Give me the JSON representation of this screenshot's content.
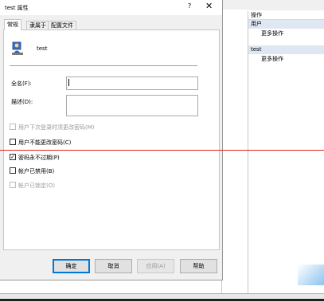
{
  "dialog": {
    "title": "test 属性",
    "help": "?",
    "close": "✕"
  },
  "tabs": [
    {
      "label": "常规"
    },
    {
      "label": "隶属于"
    },
    {
      "label": "配置文件"
    }
  ],
  "general": {
    "username": "test",
    "fullname_label": "全名(F):",
    "fullname_value": "",
    "description_label": "描述(D):",
    "description_value": "",
    "checkboxes": [
      {
        "label": "用户下次登录时须更改密码(M)",
        "checked": false,
        "enabled": false
      },
      {
        "label": "用户不能更改密码(C)",
        "checked": false,
        "enabled": true
      },
      {
        "label": "密码永不过期(P)",
        "checked": true,
        "enabled": true
      },
      {
        "label": "帐户已禁用(B)",
        "checked": false,
        "enabled": true
      },
      {
        "label": "帐户已锁定(O)",
        "checked": false,
        "enabled": false
      }
    ]
  },
  "buttons": {
    "ok": "确定",
    "cancel": "取消",
    "apply": "应用(A)",
    "help": "帮助"
  },
  "actions": {
    "header": "操作",
    "groups": [
      {
        "title": "用户",
        "item": "更多操作"
      },
      {
        "title": "test",
        "item": "更多操作"
      }
    ]
  }
}
